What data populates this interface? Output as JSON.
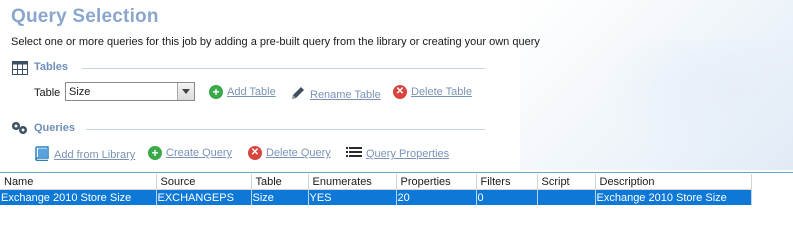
{
  "header": {
    "title": "Query Selection",
    "subtitle": "Select one or more queries for this job by adding a pre-built query from the library or creating your own query"
  },
  "tables_section": {
    "title": "Tables",
    "table_label": "Table",
    "table_select_value": "Size",
    "actions": {
      "add": "Add Table",
      "rename": "Rename Table",
      "delete": "Delete Table"
    }
  },
  "queries_section": {
    "title": "Queries",
    "actions": {
      "add_from_library": "Add from Library",
      "create": "Create Query",
      "delete": "Delete Query",
      "properties": "Query Properties"
    }
  },
  "grid": {
    "columns": [
      "Name",
      "Source",
      "Table",
      "Enumerates",
      "Properties",
      "Filters",
      "Script",
      "Description"
    ],
    "rows": [
      [
        "Exchange 2010 Store Size",
        "EXCHANGEPS",
        "Size",
        "YES",
        "20",
        "0",
        "",
        "Exchange 2010 Store Size"
      ]
    ]
  },
  "colors": {
    "title": "#8aa6cd",
    "section": "#6f8fba",
    "link": "#7a93b6",
    "selection": "#0e78d6",
    "add_green": "#3aa94a",
    "delete_red": "#d8453c"
  },
  "icons": {
    "tables": "table-grid-icon",
    "queries": "gears-icon",
    "add": "plus-circle-icon",
    "rename": "pencil-icon",
    "delete": "x-circle-icon",
    "library": "book-icon",
    "properties": "list-icon"
  }
}
